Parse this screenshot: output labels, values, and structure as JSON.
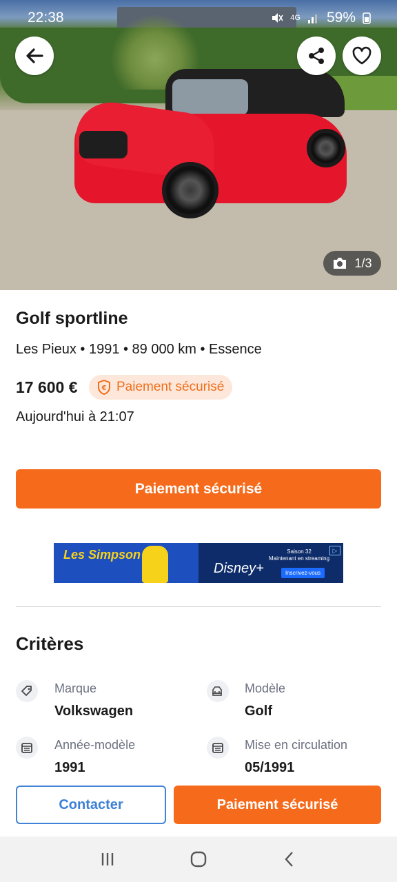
{
  "status_bar": {
    "time": "22:38",
    "battery": "59%",
    "network": "4G"
  },
  "gallery": {
    "counter": "1/3"
  },
  "listing": {
    "title": "Golf sportline",
    "subtitle": "Les Pieux • 1991 • 89 000 km • Essence",
    "price": "17 600 €",
    "secure_badge": "Paiement sécurisé",
    "date": "Aujourd'hui à 21:07"
  },
  "cta_main": "Paiement sécurisé",
  "ad": {
    "brand_left": "Les Simpson",
    "brand_right": "Disney+",
    "season": "Saison 32",
    "season_sub": "Maintenant en streaming",
    "cta": "Inscrivez-vous"
  },
  "criteria": {
    "title": "Critères",
    "items": [
      {
        "label": "Marque",
        "value": "Volkswagen",
        "icon": "tag-icon"
      },
      {
        "label": "Modèle",
        "value": "Golf",
        "icon": "car-icon"
      },
      {
        "label": "Année-modèle",
        "value": "1991",
        "icon": "calendar-icon"
      },
      {
        "label": "Mise en circulation",
        "value": "05/1991",
        "icon": "calendar-icon"
      }
    ]
  },
  "actions": {
    "contact": "Contacter",
    "pay": "Paiement sécurisé"
  },
  "colors": {
    "accent": "#f56b1b",
    "link": "#3d80d6",
    "badge_bg": "#fde7da"
  }
}
